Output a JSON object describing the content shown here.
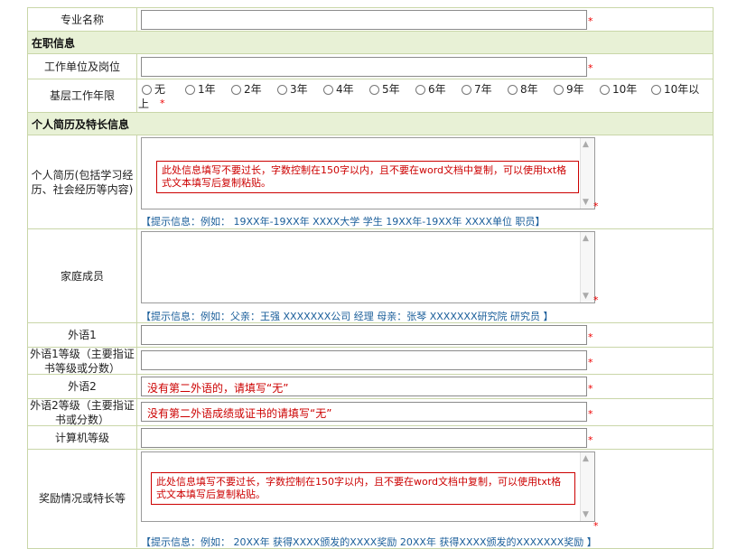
{
  "fields": {
    "major": {
      "label": "专业名称",
      "value": ""
    },
    "employer": {
      "label": "工作单位及岗位",
      "value": ""
    },
    "years": {
      "label": "基层工作年限",
      "options": [
        "无",
        "1年",
        "2年",
        "3年",
        "4年",
        "5年",
        "6年",
        "7年",
        "8年",
        "9年",
        "10年",
        "10年以"
      ],
      "wrap": "上"
    },
    "resume": {
      "label": "个人简历(包括学习经历、社会经历等内容)",
      "note": "此处信息填写不要过长，字数控制在150字以内，且不要在word文档中复制，可以使用txt格式文本填写后复制粘贴。",
      "hint": "【提示信息：例如：  19XX年-19XX年  XXXX大学  学生  19XX年-19XX年  XXXX单位  职员】"
    },
    "family": {
      "label": "家庭成员",
      "hint": "【提示信息：例如：父亲：王强  XXXXXXX公司  经理  母亲：张琴  XXXXXXX研究院  研究员  】"
    },
    "lang1": {
      "label": "外语1",
      "value": ""
    },
    "lang1_level": {
      "label": "外语1等级（主要指证书等级或分数）",
      "value": ""
    },
    "lang2": {
      "label": "外语2",
      "value": "没有第二外语的，请填写“无”"
    },
    "lang2_level": {
      "label": "外语2等级（主要指证书或分数）",
      "value": "没有第二外语成绩或证书的请填写“无”"
    },
    "computer": {
      "label": "计算机等级",
      "value": ""
    },
    "awards": {
      "label": "奖励情况或特长等",
      "note": "此处信息填写不要过长，字数控制在150字以内，且不要在word文档中复制，可以使用txt格式文本填写后复制粘贴。",
      "hint": "【提示信息：例如：  20XX年  获得XXXX颁发的XXXX奖励  20XX年  获得XXXX颁发的XXXXXXX奖励  】"
    }
  },
  "sections": {
    "job": "在职信息",
    "resume": "个人简历及特长信息"
  },
  "required_mark": "*",
  "colors": {
    "border": "#c9d6a8",
    "section_bg": "#e8f1d6",
    "required": "#ee0000",
    "hint": "#1a5e9a"
  }
}
